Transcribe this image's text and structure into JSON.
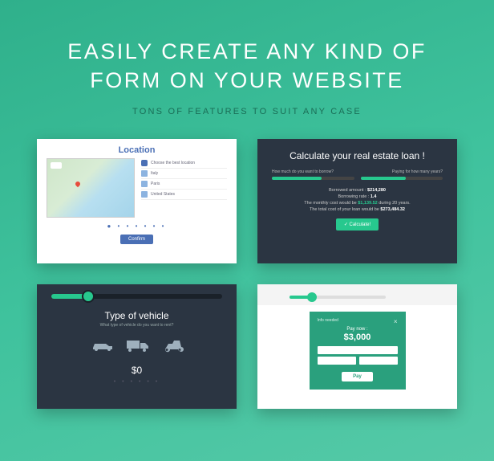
{
  "hero": {
    "title_line1": "EASILY CREATE ANY KIND OF",
    "title_line2": "FORM ON YOUR WEBSITE",
    "subtitle": "TONS OF FEATURES TO SUIT ANY CASE"
  },
  "card1": {
    "title": "Location",
    "items": [
      "Choose the best location",
      "Italy",
      "Paris",
      "United States"
    ],
    "button": "Confirm"
  },
  "card2": {
    "title": "Calculate your real estate loan !",
    "label_left": "How much do you want to borrow?",
    "label_right": "Paying for how many years?",
    "line1_label": "Borrowed amount :",
    "line1_val": "$214,280",
    "line2_label": "Borrowing rate :",
    "line2_val": "1.4",
    "line3_prefix": "The monthly cost would be",
    "line3_accent": "$1,139.52",
    "line3_suffix": "during 20 years.",
    "line4_prefix": "The total cost of your loan would be",
    "line4_val": "$273,484.32",
    "button": "✓ Calculate!"
  },
  "card3": {
    "title": "Type of vehicle",
    "subtitle": "What type of vehicle do you want to rent?",
    "price": "$0"
  },
  "card4": {
    "widget_title": "Info needed",
    "close": "×",
    "pay_now_label": "Pay now :",
    "amount": "$3,000",
    "pay_button": "Pay"
  }
}
